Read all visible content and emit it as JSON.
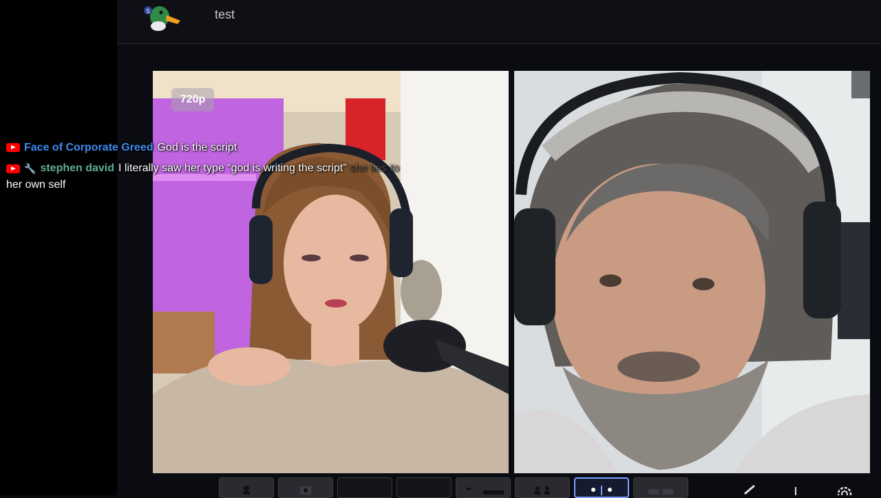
{
  "header": {
    "title": "test",
    "logo_icon": "duck-logo-icon"
  },
  "stage": {
    "quality_badge": "720p"
  },
  "chat": {
    "messages": [
      {
        "source_icon": "youtube-icon",
        "author": "Face of Corporate Greed",
        "author_color": "#3b8cf0",
        "text": "God is the script"
      },
      {
        "source_icon": "youtube-icon",
        "badge_icon": "wrench-icon",
        "author": "stephen david",
        "author_color": "#5fae8e",
        "text": "I literally saw her type “god is writing the script”",
        "text_faded": "she lies to",
        "text_line2": "her own self"
      }
    ]
  },
  "toolbar": {
    "layouts": [
      "solo-layout",
      "solo-layout-alt",
      "empty-layout",
      "empty-layout",
      "pip-layout",
      "two-up-layout",
      "side-by-side-layout",
      "grid-layout"
    ],
    "active_index": 6,
    "tools": [
      "pen-icon",
      "plus-icon",
      "gear-icon"
    ]
  }
}
